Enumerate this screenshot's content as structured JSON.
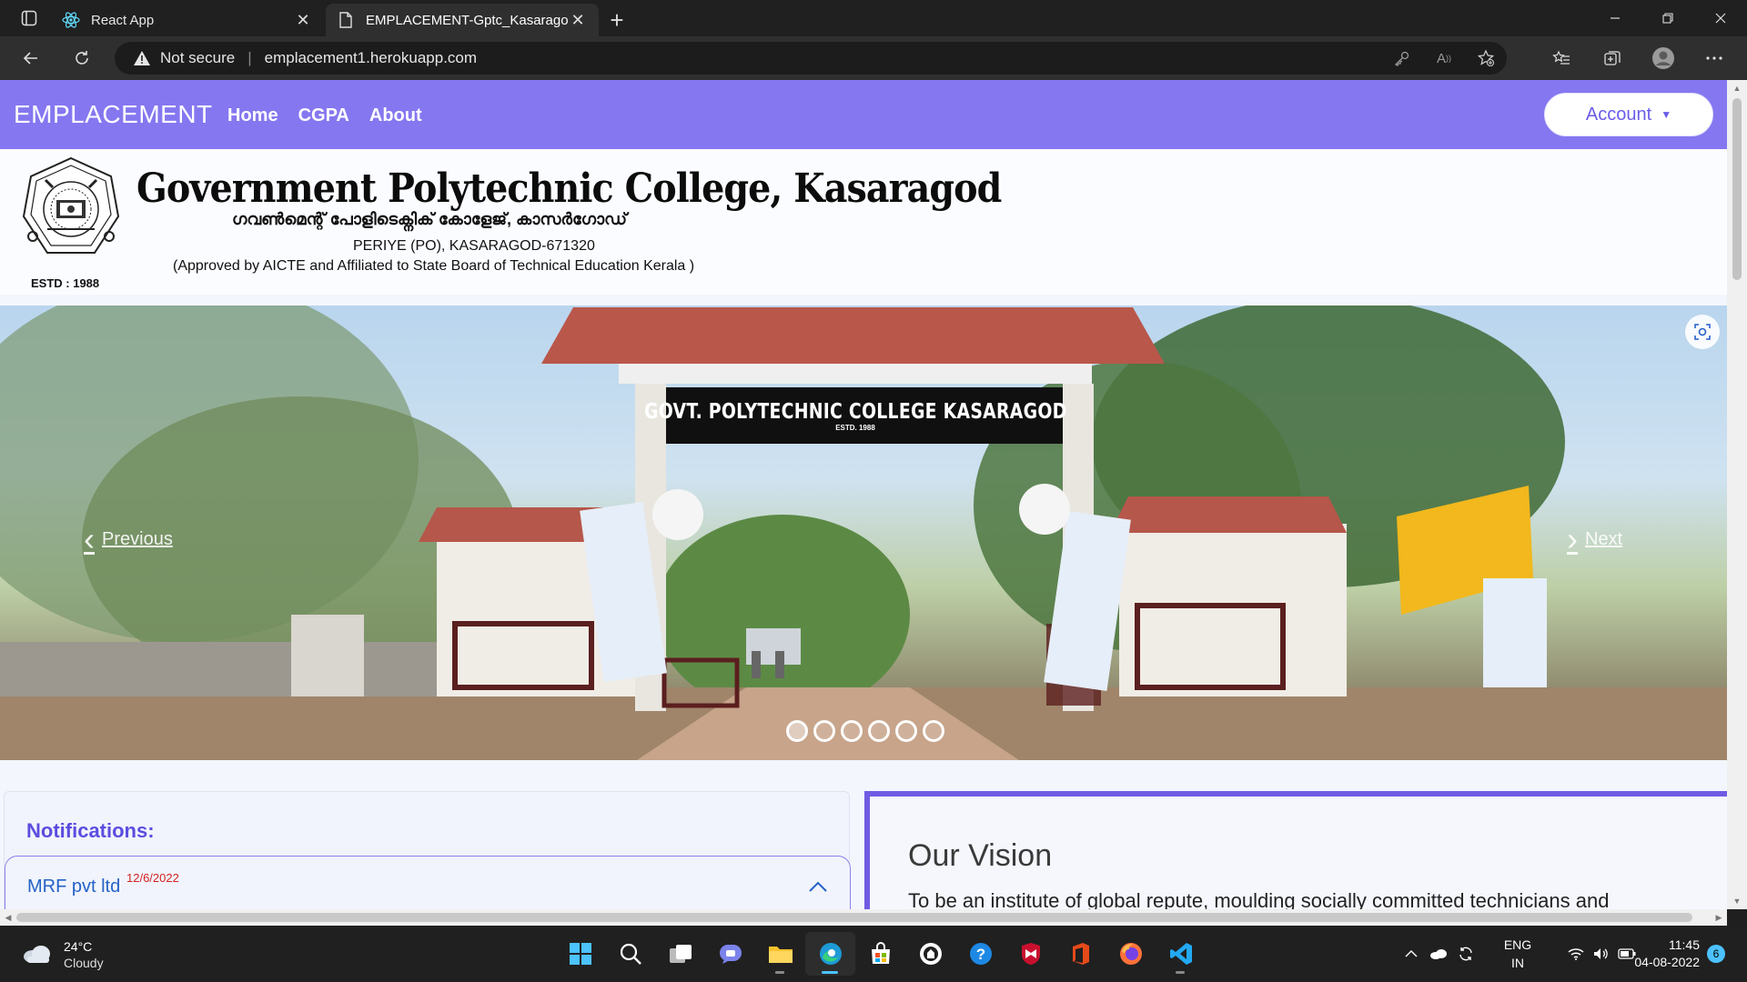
{
  "browser": {
    "tabs": [
      {
        "title": "React App",
        "icon": "react-icon",
        "active": false
      },
      {
        "title": "EMPLACEMENT-Gptc_Kasaragod",
        "icon": "page-icon",
        "active": true
      }
    ],
    "address": {
      "security_label": "Not secure",
      "url": "emplacement1.herokuapp.com"
    }
  },
  "navbar": {
    "brand": "EMPLACEMENT",
    "links": [
      "Home",
      "CGPA",
      "About"
    ],
    "account_label": "Account"
  },
  "college": {
    "name": "Government Polytechnic College, Kasaragod",
    "name_malayalam": "ഗവൺമെന്റ് പോളിടെക്നിക് കോളേജ്, കാസർഗോഡ്",
    "address": "PERIYE (PO), KASARAGOD-671320",
    "affiliation": "(Approved by AICTE and Affiliated to State Board of Technical Education Kerala )",
    "estd": "ESTD : 1988"
  },
  "carousel": {
    "prev_label": "Previous",
    "next_label": "Next",
    "slide_count": 6,
    "active_index": 0,
    "gate_sign": "GOVT. POLYTECHNIC COLLEGE KASARAGOD",
    "gate_sign_sub": "ESTD. 1988"
  },
  "notifications": {
    "title": "Notifications:",
    "items": [
      {
        "company": "MRF pvt ltd",
        "date": "12/6/2022"
      }
    ]
  },
  "vision": {
    "title": "Our Vision",
    "text": "To be an institute of global repute, moulding socially committed technicians and"
  },
  "taskbar": {
    "weather": {
      "temp": "24°C",
      "condition": "Cloudy"
    },
    "language": {
      "line1": "ENG",
      "line2": "IN"
    },
    "time": "11:45",
    "date": "04-08-2022",
    "notification_count": "6"
  },
  "colors": {
    "navbar": "#8577f0",
    "accent": "#6f5be3",
    "notification_date": "#d32222",
    "link_blue": "#2561c7"
  }
}
